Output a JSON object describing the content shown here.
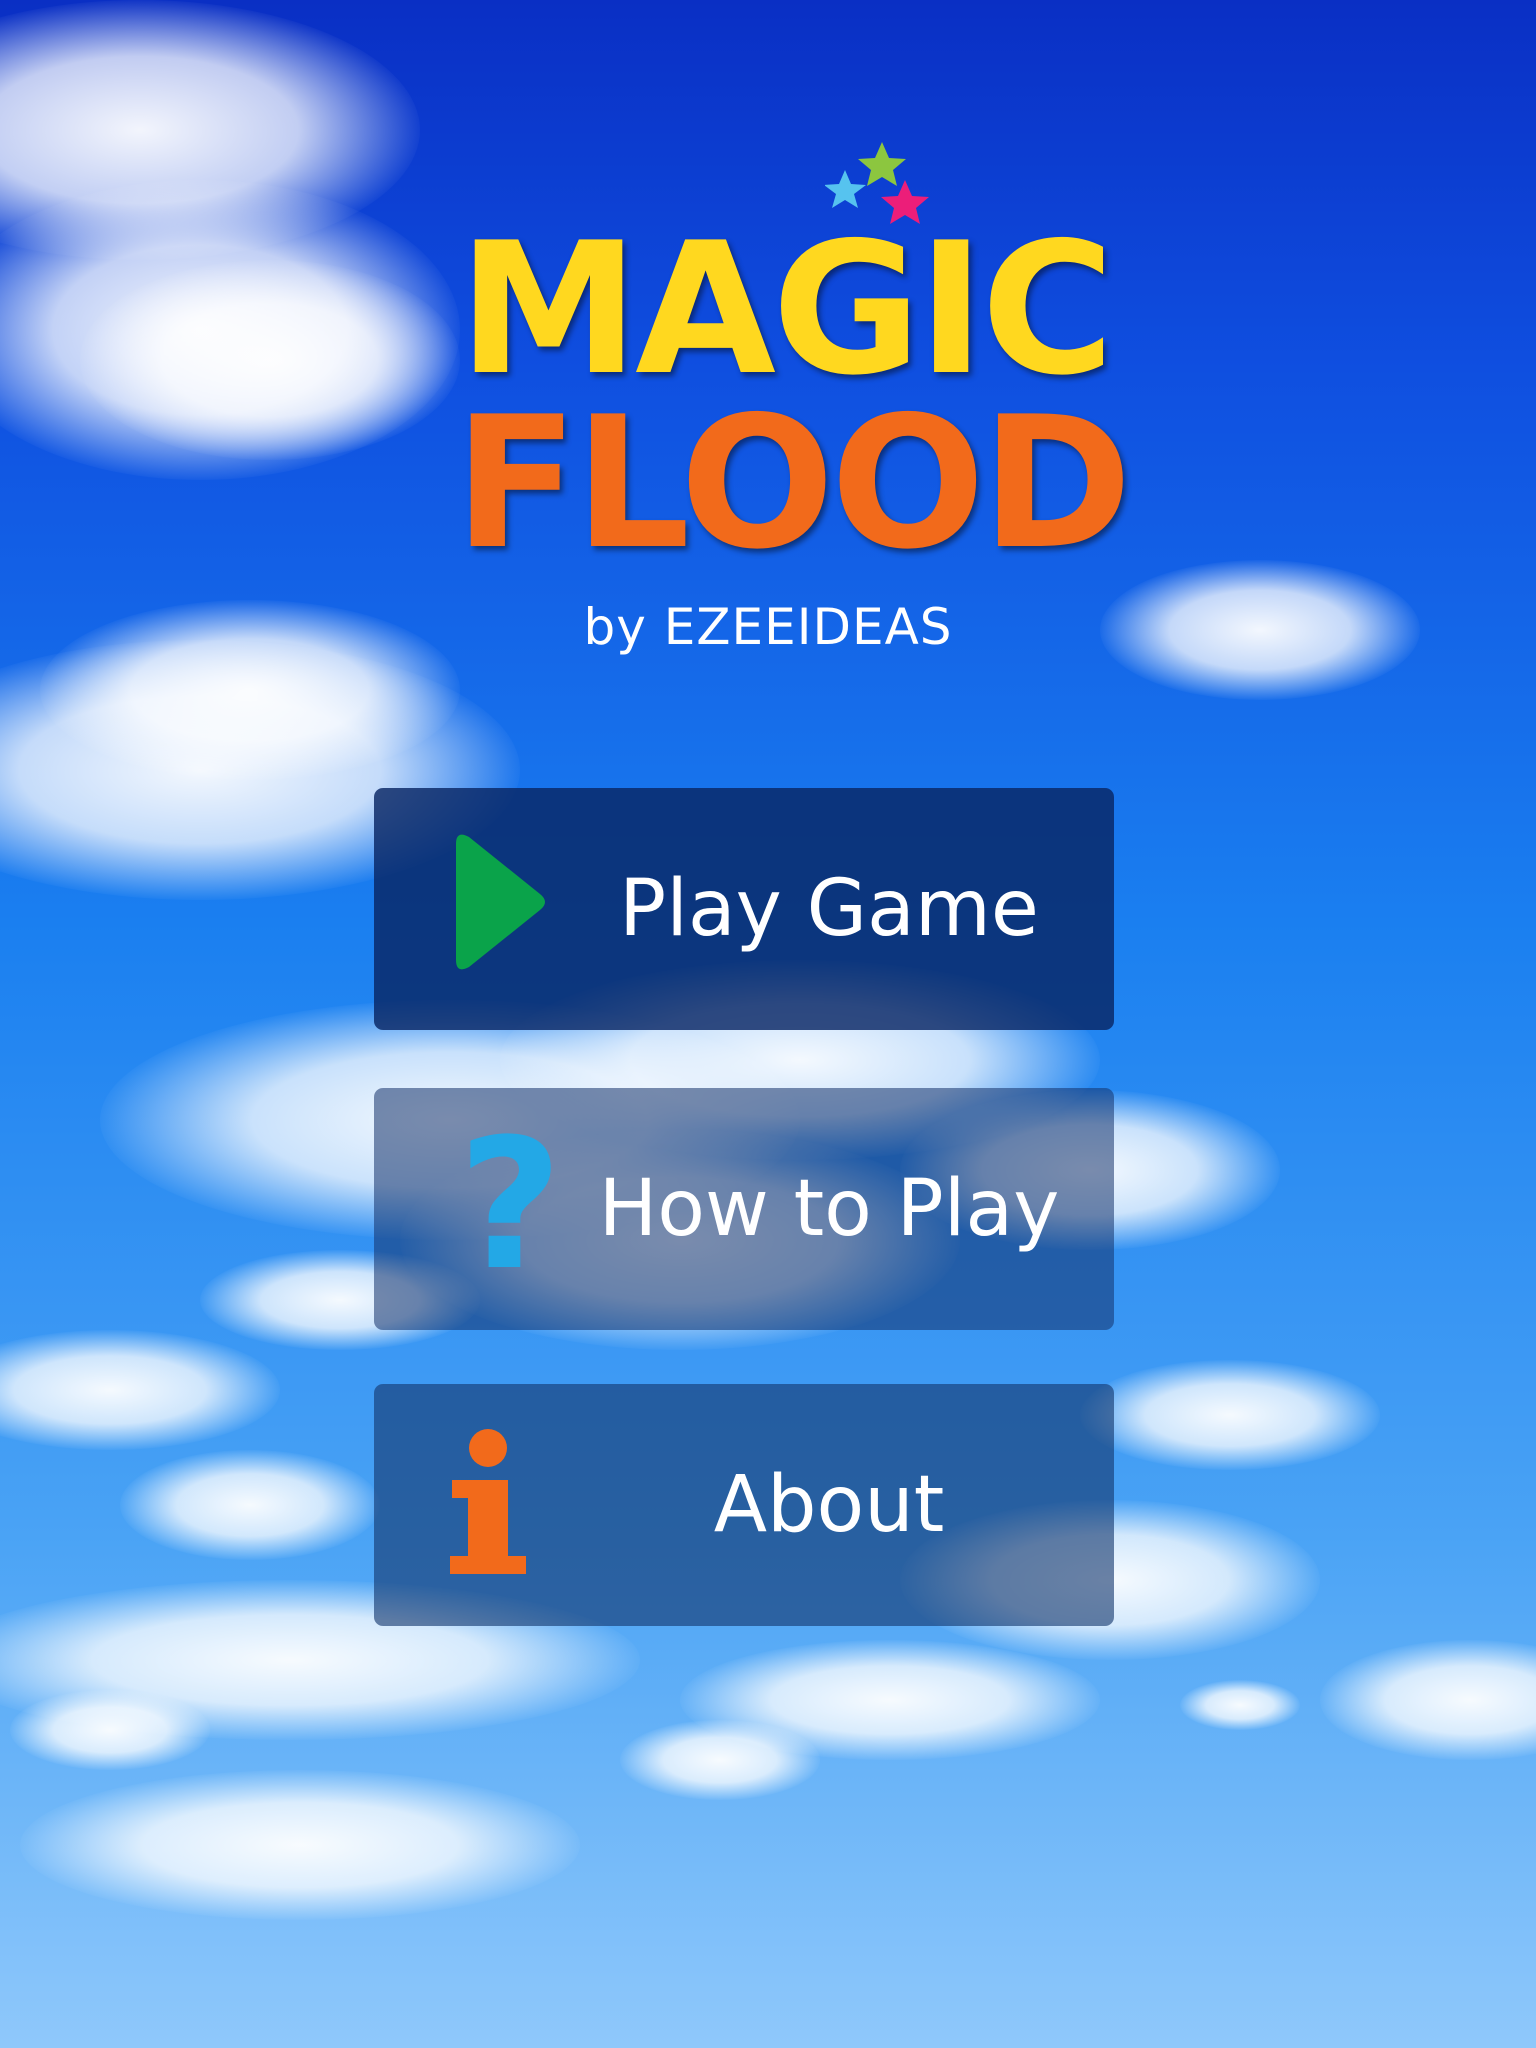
{
  "logo": {
    "line1": "MAGIC",
    "line2": "FLOOD"
  },
  "byline": "by EZEEIDEAS",
  "menu": {
    "items": [
      {
        "label": "Play Game",
        "icon": "play-icon"
      },
      {
        "label": "How to Play",
        "icon": "question-icon"
      },
      {
        "label": "About",
        "icon": "info-icon"
      }
    ],
    "question_glyph": "?"
  },
  "colors": {
    "logo_yellow": "#ffd81f",
    "logo_orange": "#f26a1b",
    "play_green": "#0aa34a",
    "question_blue": "#23a8e6",
    "info_orange": "#f26a1b",
    "star_blue": "#56c3ef",
    "star_green": "#8cc63f",
    "star_pink": "#ec1e79"
  }
}
